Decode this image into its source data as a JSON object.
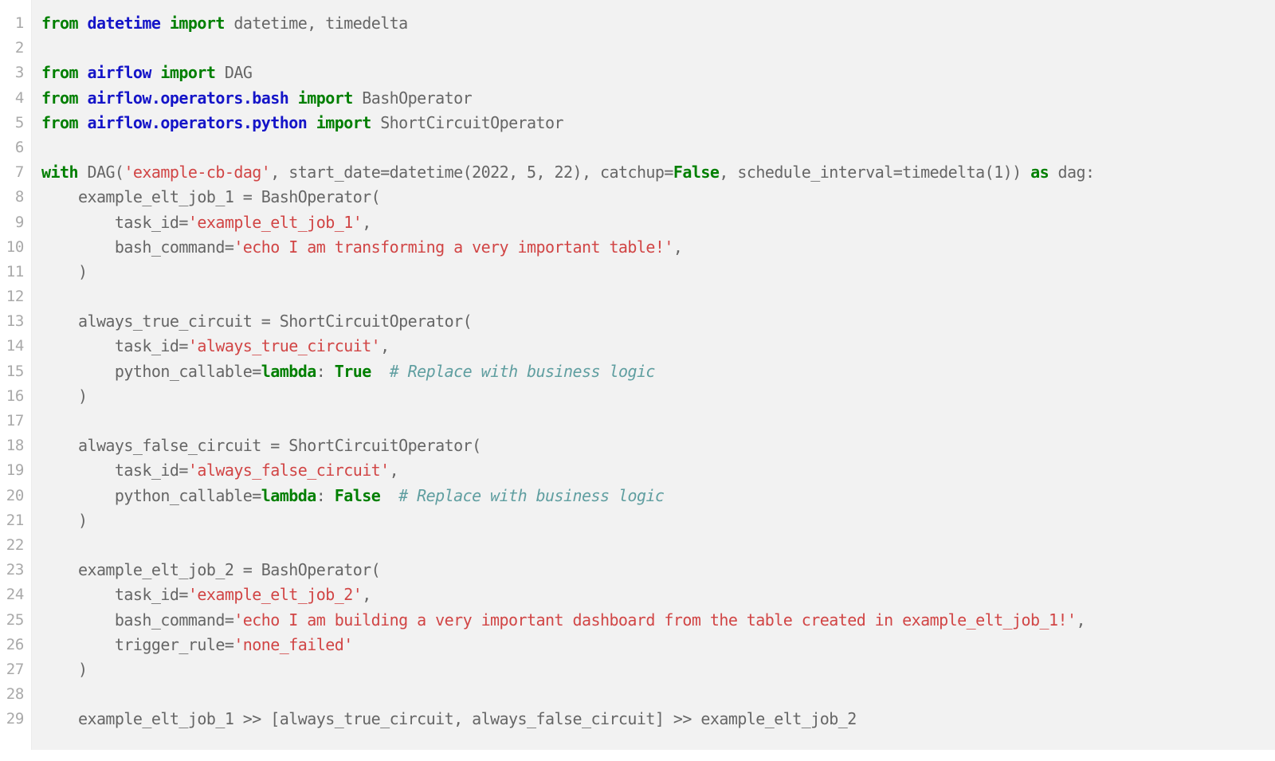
{
  "editor": {
    "language": "python",
    "background_color": "#f2f2f2",
    "gutter_color": "#ffffff",
    "line_number_color": "#a9a9a9",
    "plain_text_color": "#666666",
    "keyword_color": "#007f00",
    "namespace_color": "#1414c8",
    "string_color": "#d14545",
    "comment_color": "#5f9ea0",
    "first_line_number": 1,
    "last_line_number": 29,
    "total_lines": 29
  },
  "code": {
    "plain_text": "from datetime import datetime, timedelta\n\nfrom airflow import DAG\nfrom airflow.operators.bash import BashOperator\nfrom airflow.operators.python import ShortCircuitOperator\n\nwith DAG('example-cb-dag', start_date=datetime(2022, 5, 22), catchup=False, schedule_interval=timedelta(1)) as dag:\n    example_elt_job_1 = BashOperator(\n        task_id='example_elt_job_1',\n        bash_command='echo I am transforming a very important table!',\n    )\n\n    always_true_circuit = ShortCircuitOperator(\n        task_id='always_true_circuit',\n        python_callable=lambda: True  # Replace with business logic\n    )\n\n    always_false_circuit = ShortCircuitOperator(\n        task_id='always_false_circuit',\n        python_callable=lambda: False  # Replace with business logic\n    )\n\n    example_elt_job_2 = BashOperator(\n        task_id='example_elt_job_2',\n        bash_command='echo I am building a very important dashboard from the table created in example_elt_job_1!',\n        trigger_rule='none_failed'\n    )\n\n    example_elt_job_1 >> [always_true_circuit, always_false_circuit] >> example_elt_job_2",
    "lines": [
      {
        "number": "1",
        "tokens": [
          {
            "t": "from ",
            "c": "k"
          },
          {
            "t": "datetime",
            "c": "nn"
          },
          {
            "t": " import",
            "c": "k"
          },
          {
            "t": " datetime, timedelta",
            "c": "n"
          }
        ]
      },
      {
        "number": "2",
        "tokens": []
      },
      {
        "number": "3",
        "tokens": [
          {
            "t": "from ",
            "c": "k"
          },
          {
            "t": "airflow",
            "c": "nn"
          },
          {
            "t": " import",
            "c": "k"
          },
          {
            "t": " DAG",
            "c": "n"
          }
        ]
      },
      {
        "number": "4",
        "tokens": [
          {
            "t": "from ",
            "c": "k"
          },
          {
            "t": "airflow.operators.bash",
            "c": "nn"
          },
          {
            "t": " import",
            "c": "k"
          },
          {
            "t": " BashOperator",
            "c": "n"
          }
        ]
      },
      {
        "number": "5",
        "tokens": [
          {
            "t": "from ",
            "c": "k"
          },
          {
            "t": "airflow.operators.python",
            "c": "nn"
          },
          {
            "t": " import",
            "c": "k"
          },
          {
            "t": " ShortCircuitOperator",
            "c": "n"
          }
        ]
      },
      {
        "number": "6",
        "tokens": []
      },
      {
        "number": "7",
        "tokens": [
          {
            "t": "with",
            "c": "k"
          },
          {
            "t": " DAG(",
            "c": "n"
          },
          {
            "t": "'example-cb-dag'",
            "c": "s"
          },
          {
            "t": ", start_date=datetime(2022, 5, 22), catchup=",
            "c": "n"
          },
          {
            "t": "False",
            "c": "k"
          },
          {
            "t": ", schedule_interval=timedelta(1)) ",
            "c": "n"
          },
          {
            "t": "as",
            "c": "k"
          },
          {
            "t": " dag:",
            "c": "n"
          }
        ]
      },
      {
        "number": "8",
        "tokens": [
          {
            "t": "    example_elt_job_1 = BashOperator(",
            "c": "n"
          }
        ]
      },
      {
        "number": "9",
        "tokens": [
          {
            "t": "        task_id=",
            "c": "n"
          },
          {
            "t": "'example_elt_job_1'",
            "c": "s"
          },
          {
            "t": ",",
            "c": "n"
          }
        ]
      },
      {
        "number": "10",
        "tokens": [
          {
            "t": "        bash_command=",
            "c": "n"
          },
          {
            "t": "'echo I am transforming a very important table!'",
            "c": "s"
          },
          {
            "t": ",",
            "c": "n"
          }
        ]
      },
      {
        "number": "11",
        "tokens": [
          {
            "t": "    )",
            "c": "n"
          }
        ]
      },
      {
        "number": "12",
        "tokens": []
      },
      {
        "number": "13",
        "tokens": [
          {
            "t": "    always_true_circuit = ShortCircuitOperator(",
            "c": "n"
          }
        ]
      },
      {
        "number": "14",
        "tokens": [
          {
            "t": "        task_id=",
            "c": "n"
          },
          {
            "t": "'always_true_circuit'",
            "c": "s"
          },
          {
            "t": ",",
            "c": "n"
          }
        ]
      },
      {
        "number": "15",
        "tokens": [
          {
            "t": "        python_callable=",
            "c": "n"
          },
          {
            "t": "lambda",
            "c": "k"
          },
          {
            "t": ": ",
            "c": "n"
          },
          {
            "t": "True",
            "c": "k"
          },
          {
            "t": "  ",
            "c": "n"
          },
          {
            "t": "# Replace with business logic",
            "c": "c"
          }
        ]
      },
      {
        "number": "16",
        "tokens": [
          {
            "t": "    )",
            "c": "n"
          }
        ]
      },
      {
        "number": "17",
        "tokens": []
      },
      {
        "number": "18",
        "tokens": [
          {
            "t": "    always_false_circuit = ShortCircuitOperator(",
            "c": "n"
          }
        ]
      },
      {
        "number": "19",
        "tokens": [
          {
            "t": "        task_id=",
            "c": "n"
          },
          {
            "t": "'always_false_circuit'",
            "c": "s"
          },
          {
            "t": ",",
            "c": "n"
          }
        ]
      },
      {
        "number": "20",
        "tokens": [
          {
            "t": "        python_callable=",
            "c": "n"
          },
          {
            "t": "lambda",
            "c": "k"
          },
          {
            "t": ": ",
            "c": "n"
          },
          {
            "t": "False",
            "c": "k"
          },
          {
            "t": "  ",
            "c": "n"
          },
          {
            "t": "# Replace with business logic",
            "c": "c"
          }
        ]
      },
      {
        "number": "21",
        "tokens": [
          {
            "t": "    )",
            "c": "n"
          }
        ]
      },
      {
        "number": "22",
        "tokens": []
      },
      {
        "number": "23",
        "tokens": [
          {
            "t": "    example_elt_job_2 = BashOperator(",
            "c": "n"
          }
        ]
      },
      {
        "number": "24",
        "tokens": [
          {
            "t": "        task_id=",
            "c": "n"
          },
          {
            "t": "'example_elt_job_2'",
            "c": "s"
          },
          {
            "t": ",",
            "c": "n"
          }
        ]
      },
      {
        "number": "25",
        "tokens": [
          {
            "t": "        bash_command=",
            "c": "n"
          },
          {
            "t": "'echo I am building a very important dashboard from the table created in example_elt_job_1!'",
            "c": "s"
          },
          {
            "t": ",",
            "c": "n"
          }
        ]
      },
      {
        "number": "26",
        "tokens": [
          {
            "t": "        trigger_rule=",
            "c": "n"
          },
          {
            "t": "'none_failed'",
            "c": "s"
          }
        ]
      },
      {
        "number": "27",
        "tokens": [
          {
            "t": "    )",
            "c": "n"
          }
        ]
      },
      {
        "number": "28",
        "tokens": []
      },
      {
        "number": "29",
        "tokens": [
          {
            "t": "    example_elt_job_1 >> [always_true_circuit, always_false_circuit] >> example_elt_job_2",
            "c": "n"
          }
        ]
      }
    ]
  }
}
